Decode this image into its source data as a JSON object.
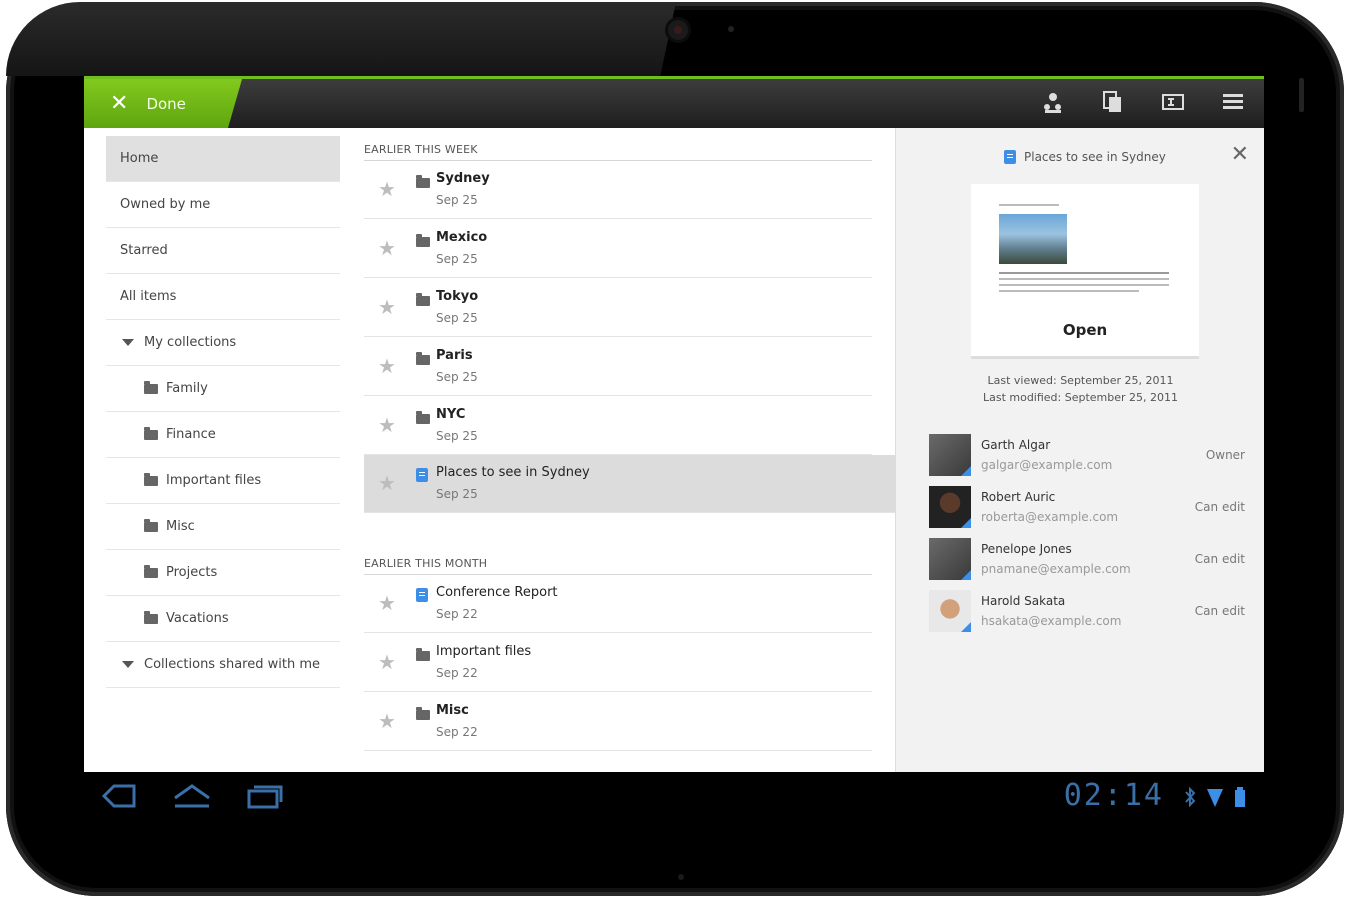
{
  "actionbar": {
    "done_label": "Done",
    "icons": [
      "share-icon",
      "copy-icon",
      "rename-icon",
      "menu-icon"
    ]
  },
  "sidebar": {
    "items": [
      {
        "label": "Home",
        "selected": true,
        "type": "nav"
      },
      {
        "label": "Owned by me",
        "type": "nav"
      },
      {
        "label": "Starred",
        "type": "nav"
      },
      {
        "label": "All items",
        "type": "nav"
      },
      {
        "label": "My collections",
        "type": "group"
      },
      {
        "label": "Family",
        "type": "folder"
      },
      {
        "label": "Finance",
        "type": "folder"
      },
      {
        "label": "Important files",
        "type": "folder"
      },
      {
        "label": "Misc",
        "type": "folder"
      },
      {
        "label": "Projects",
        "type": "folder"
      },
      {
        "label": "Vacations",
        "type": "folder"
      },
      {
        "label": "Collections shared with me",
        "type": "group"
      }
    ]
  },
  "main": {
    "sections": [
      {
        "header": "EARLIER THIS WEEK",
        "rows": [
          {
            "title": "Sydney",
            "date": "Sep 25",
            "icon": "folder-icon"
          },
          {
            "title": "Mexico",
            "date": "Sep 25",
            "icon": "folder-icon"
          },
          {
            "title": "Tokyo",
            "date": "Sep 25",
            "icon": "folder-icon"
          },
          {
            "title": "Paris",
            "date": "Sep 25",
            "icon": "folder-icon"
          },
          {
            "title": "NYC",
            "date": "Sep 25",
            "icon": "folder-icon"
          },
          {
            "title": "Places to see in Sydney",
            "date": "Sep 25",
            "icon": "document-icon",
            "selected": true
          }
        ]
      },
      {
        "header": "EARLIER THIS MONTH",
        "rows": [
          {
            "title": "Conference Report",
            "date": "Sep 22",
            "icon": "document-icon"
          },
          {
            "title": "Important files",
            "date": "Sep 22",
            "icon": "folder-icon"
          },
          {
            "title": "Misc",
            "date": "Sep 22",
            "icon": "folder-icon"
          }
        ]
      }
    ]
  },
  "detail": {
    "title": "Places to see in Sydney",
    "open_label": "Open",
    "last_viewed": "Last viewed: September 25, 2011",
    "last_modified": "Last modified: September 25, 2011",
    "people": [
      {
        "name": "Garth Algar",
        "email": "galgar@example.com",
        "role": "Owner"
      },
      {
        "name": "Robert Auric",
        "email": "roberta@example.com",
        "role": "Can edit"
      },
      {
        "name": "Penelope Jones",
        "email": "pnamane@example.com",
        "role": "Can edit"
      },
      {
        "name": "Harold Sakata",
        "email": "hsakata@example.com",
        "role": "Can edit"
      }
    ]
  },
  "systembar": {
    "clock": "02:14",
    "icons": [
      "back-icon",
      "home-icon",
      "recent-apps-icon",
      "bluetooth-icon",
      "wifi-icon",
      "battery-icon"
    ]
  },
  "colors": {
    "accent_green": "#6fbf1f",
    "clock_blue": "#3a6fa8",
    "doc_blue": "#3d8ee6"
  }
}
